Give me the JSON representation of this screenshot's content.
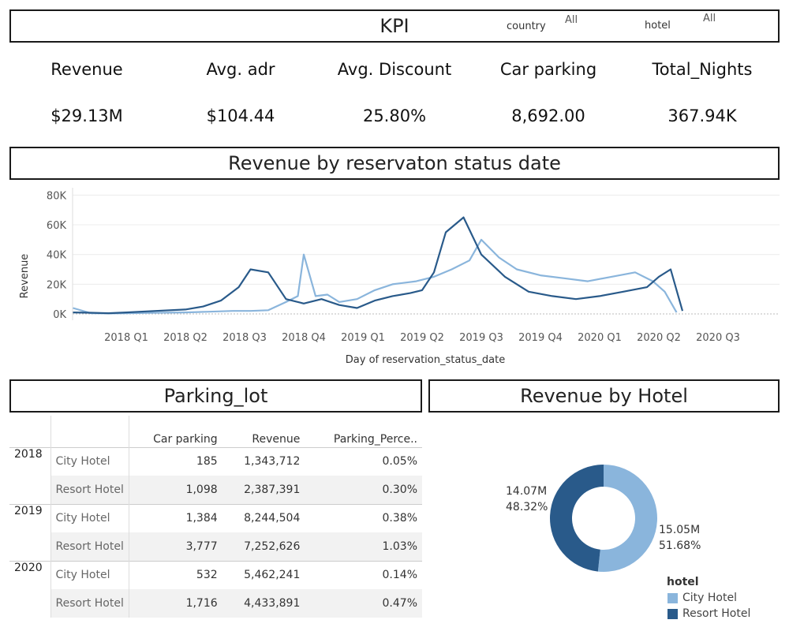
{
  "kpi_header": {
    "title": "KPI",
    "country_label": "country",
    "country_value": "All",
    "hotel_label": "hotel",
    "hotel_value": "All"
  },
  "kpis": [
    {
      "label": "Revenue",
      "value": "$29.13M"
    },
    {
      "label": "Avg. adr",
      "value": "$104.44"
    },
    {
      "label": "Avg. Discount",
      "value": "25.80%"
    },
    {
      "label": "Car parking",
      "value": "8,692.00"
    },
    {
      "label": "Total_Nights",
      "value": "367.94K"
    }
  ],
  "colors": {
    "city": "#8ab5dc",
    "resort": "#295a8a",
    "border": "#1a1a1a"
  },
  "revenue_section": {
    "title": "Revenue by reservaton status date"
  },
  "parking_section": {
    "title": "Parking_lot",
    "columns": [
      "Car parking",
      "Revenue",
      "Parking_Perce.."
    ],
    "groups": [
      {
        "year": "2018",
        "rows": [
          {
            "hotel": "City Hotel",
            "car_parking": "185",
            "revenue": "1,343,712",
            "pct": "0.05%"
          },
          {
            "hotel": "Resort Hotel",
            "car_parking": "1,098",
            "revenue": "2,387,391",
            "pct": "0.30%"
          }
        ]
      },
      {
        "year": "2019",
        "rows": [
          {
            "hotel": "City Hotel",
            "car_parking": "1,384",
            "revenue": "8,244,504",
            "pct": "0.38%"
          },
          {
            "hotel": "Resort Hotel",
            "car_parking": "3,777",
            "revenue": "7,252,626",
            "pct": "1.03%"
          }
        ]
      },
      {
        "year": "2020",
        "rows": [
          {
            "hotel": "City Hotel",
            "car_parking": "532",
            "revenue": "5,462,241",
            "pct": "0.14%"
          },
          {
            "hotel": "Resort Hotel",
            "car_parking": "1,716",
            "revenue": "4,433,891",
            "pct": "0.47%"
          }
        ]
      }
    ]
  },
  "hotel_section": {
    "title": "Revenue by Hotel",
    "legend_title": "hotel"
  },
  "chart_data": [
    {
      "type": "line",
      "title": "Revenue by reservaton status date",
      "xlabel": "Day of reservation_status_date",
      "ylabel": "Revenue",
      "x_ticks": [
        "2018 Q1",
        "2018 Q2",
        "2018 Q3",
        "2018 Q4",
        "2019 Q1",
        "2019 Q2",
        "2019 Q3",
        "2019 Q4",
        "2020 Q1",
        "2020 Q2",
        "2020 Q3"
      ],
      "y_ticks": [
        "0K",
        "20K",
        "40K",
        "60K",
        "80K"
      ],
      "ylim": [
        0,
        85000
      ],
      "grid": true,
      "series": [
        {
          "name": "City Hotel",
          "color": "#8ab5dc",
          "t": [
            -0.9,
            -0.6,
            -0.3,
            0,
            0.5,
            1,
            1.4,
            1.8,
            2.1,
            2.4,
            2.7,
            2.9,
            3.0,
            3.2,
            3.4,
            3.6,
            3.9,
            4.2,
            4.5,
            4.9,
            5.2,
            5.5,
            5.8,
            6.0,
            6.3,
            6.6,
            7.0,
            7.4,
            7.8,
            8.2,
            8.6,
            8.9,
            9.1,
            9.3
          ],
          "values": [
            4000,
            500,
            300,
            500,
            800,
            1000,
            1500,
            2000,
            2000,
            2500,
            8000,
            12000,
            40000,
            12000,
            13000,
            8000,
            10000,
            16000,
            20000,
            22000,
            25000,
            30000,
            36000,
            50000,
            38000,
            30000,
            26000,
            24000,
            22000,
            25000,
            28000,
            22000,
            15000,
            1000
          ]
        },
        {
          "name": "Resort Hotel",
          "color": "#295a8a",
          "t": [
            -0.9,
            -0.6,
            -0.3,
            0,
            0.5,
            1,
            1.3,
            1.6,
            1.9,
            2.1,
            2.4,
            2.7,
            3.0,
            3.3,
            3.6,
            3.9,
            4.2,
            4.5,
            4.8,
            5.0,
            5.2,
            5.4,
            5.7,
            6.0,
            6.4,
            6.8,
            7.2,
            7.6,
            8.0,
            8.4,
            8.8,
            9.0,
            9.2,
            9.4
          ],
          "values": [
            1000,
            800,
            500,
            1000,
            2000,
            3000,
            5000,
            9000,
            18000,
            30000,
            28000,
            10000,
            7000,
            10000,
            6000,
            4000,
            9000,
            12000,
            14000,
            16000,
            28000,
            55000,
            65000,
            40000,
            25000,
            15000,
            12000,
            10000,
            12000,
            15000,
            18000,
            25000,
            30000,
            2000
          ]
        }
      ]
    },
    {
      "type": "pie",
      "title": "Revenue by Hotel",
      "legend_title": "hotel",
      "slices": [
        {
          "name": "City Hotel",
          "value": 15.05,
          "percent": 51.68,
          "label": "15.05M",
          "pct_label": "51.68%",
          "color": "#8ab5dc"
        },
        {
          "name": "Resort Hotel",
          "value": 14.07,
          "percent": 48.32,
          "label": "14.07M",
          "pct_label": "48.32%",
          "color": "#295a8a"
        }
      ]
    }
  ]
}
